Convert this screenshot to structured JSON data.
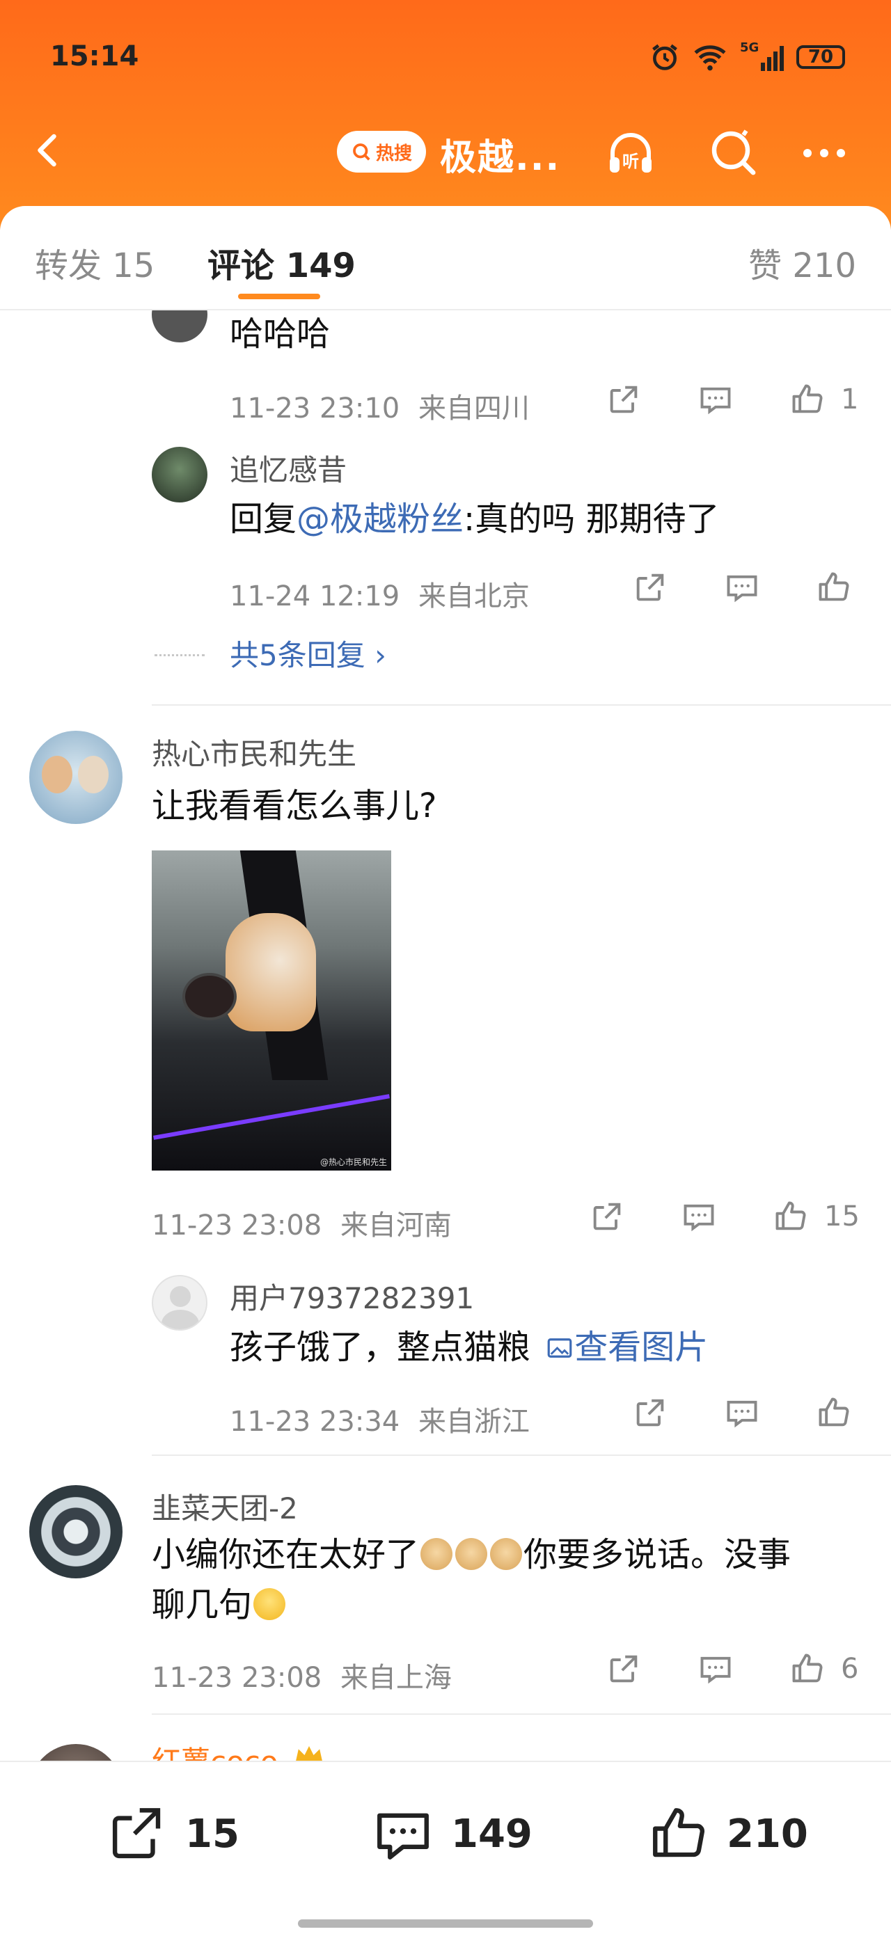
{
  "status_bar": {
    "time": "15:14",
    "battery": "70",
    "network": "5G"
  },
  "header": {
    "hot_search_label": "热搜",
    "title": "极越..."
  },
  "tabs": [
    {
      "label": "转发 15"
    },
    {
      "label": "评论 149",
      "active": true
    },
    {
      "label": "赞 210"
    }
  ],
  "comments": [
    {
      "text": "哈哈哈",
      "time": "11-23 23:10",
      "location": "来自四川",
      "likes": "1",
      "replies": [
        {
          "user": "追忆感昔",
          "reply_prefix": "回复",
          "mention": "@极越粉丝",
          "text": ":真的吗 那期待了",
          "time": "11-24 12:19",
          "location": "来自北京",
          "likes": ""
        }
      ],
      "more_replies": "共5条回复"
    },
    {
      "user": "热心市民和先生",
      "text": "让我看看怎么事儿?",
      "image_watermark": "@热心市民和先生",
      "time": "11-23 23:08",
      "location": "来自河南",
      "likes": "15",
      "replies": [
        {
          "user": "用户7937282391",
          "text": "孩子饿了，整点猫粮",
          "view_image": "查看图片",
          "time": "11-23 23:34",
          "location": "来自浙江",
          "likes": ""
        }
      ]
    },
    {
      "user": "韭菜天团-2",
      "text_part1": "小编你还在太好了",
      "text_part2": "你要多说话。没事",
      "text_line2": "聊几句",
      "time": "11-23 23:08",
      "location": "来自上海",
      "likes": "6"
    },
    {
      "user": "红薯coco"
    }
  ],
  "bottom_bar": {
    "repost_count": "15",
    "comment_count": "149",
    "like_count": "210"
  },
  "colors": {
    "accent": "#ff7a1a",
    "link": "#3d6bb5"
  }
}
